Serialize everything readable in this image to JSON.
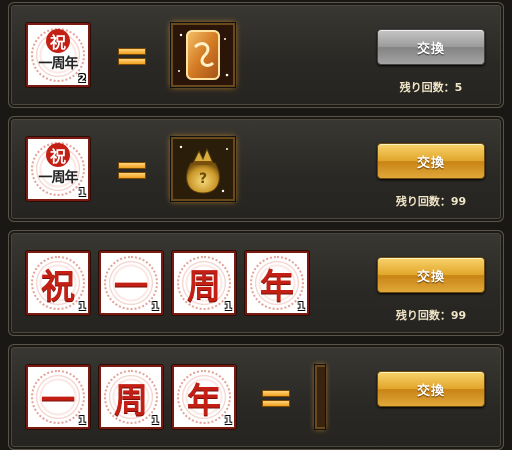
{
  "rows": [
    {
      "cost_count": "2",
      "button": {
        "label": "交換",
        "state": "disabled"
      },
      "remaining": "残り回数：5",
      "reward_icon": "golden-card-icon"
    },
    {
      "cost_count": "1",
      "button": {
        "label": "交換",
        "state": "enabled"
      },
      "remaining": "残り回数：99",
      "reward_icon": "mystery-bag-icon"
    },
    {
      "cost": [
        {
          "glyph": "祝",
          "count": "1"
        },
        {
          "glyph": "一",
          "count": "1"
        },
        {
          "glyph": "周",
          "count": "1"
        },
        {
          "glyph": "年",
          "count": "1"
        }
      ],
      "button": {
        "label": "交換",
        "state": "enabled"
      },
      "remaining": "残り回数：99"
    },
    {
      "cost": [
        {
          "glyph": "一",
          "count": "1"
        },
        {
          "glyph": "周",
          "count": "1"
        },
        {
          "glyph": "年",
          "count": "1"
        }
      ],
      "button": {
        "label": "交換",
        "state": "enabled"
      }
    }
  ],
  "combo_item": {
    "top": "祝",
    "bottom": "一周年"
  },
  "colors": {
    "accent_gold": "#e2a52a",
    "disabled_gray": "#9a9a9a",
    "seal_red": "#c31f14"
  }
}
